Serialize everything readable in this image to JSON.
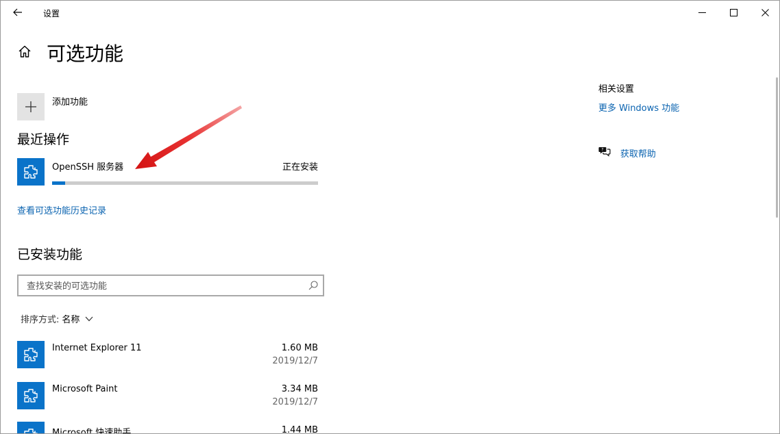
{
  "window": {
    "title": "设置"
  },
  "page": {
    "title": "可选功能"
  },
  "add_feature": {
    "label": "添加功能",
    "icon": "plus-icon"
  },
  "recent": {
    "title": "最近操作",
    "operation": {
      "name": "OpenSSH 服务器",
      "status": "正在安装",
      "progress": 0.05
    },
    "history_link": "查看可选功能历史记录"
  },
  "installed": {
    "title": "已安装功能",
    "search_placeholder": "查找安装的可选功能",
    "sort_prefix": "排序方式:",
    "sort_value": "名称",
    "items": [
      {
        "name": "Internet Explorer 11",
        "size": "1.60 MB",
        "date": "2019/12/7"
      },
      {
        "name": "Microsoft Paint",
        "size": "3.34 MB",
        "date": "2019/12/7"
      },
      {
        "name": "Microsoft 快速助手",
        "size": "1.44 MB"
      }
    ]
  },
  "related": {
    "title": "相关设置",
    "more_windows_link": "更多 Windows 功能",
    "help_link": "获取帮助"
  },
  "colors": {
    "accent": "#0a73c9",
    "link": "#0a63b0",
    "annotation_arrow": "#e01b1b"
  }
}
